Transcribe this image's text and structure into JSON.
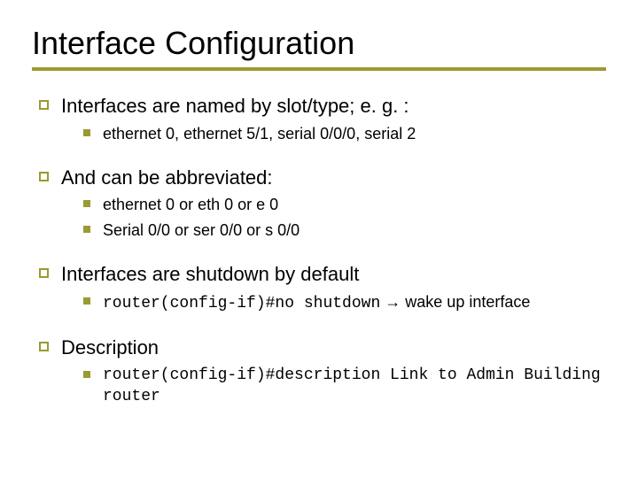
{
  "title": "Interface Configuration",
  "items": {
    "p1": {
      "text": "Interfaces are named by slot/type; e. g. :",
      "sub": {
        "a": "ethernet 0, ethernet 5/1, serial 0/0/0, serial 2"
      }
    },
    "p2": {
      "text": "And can be abbreviated:",
      "sub": {
        "a": "ethernet 0 or eth 0 or e 0",
        "b": "Serial 0/0 or ser 0/0 or s 0/0"
      }
    },
    "p3": {
      "text": "Interfaces are shutdown by default",
      "sub": {
        "a_code": "router(config-if)#no shutdown",
        "a_arrow": " → ",
        "a_tail": "wake up interface"
      }
    },
    "p4": {
      "text": "Description",
      "sub": {
        "a": "router(config-if)#description Link to Admin Building router"
      }
    }
  }
}
